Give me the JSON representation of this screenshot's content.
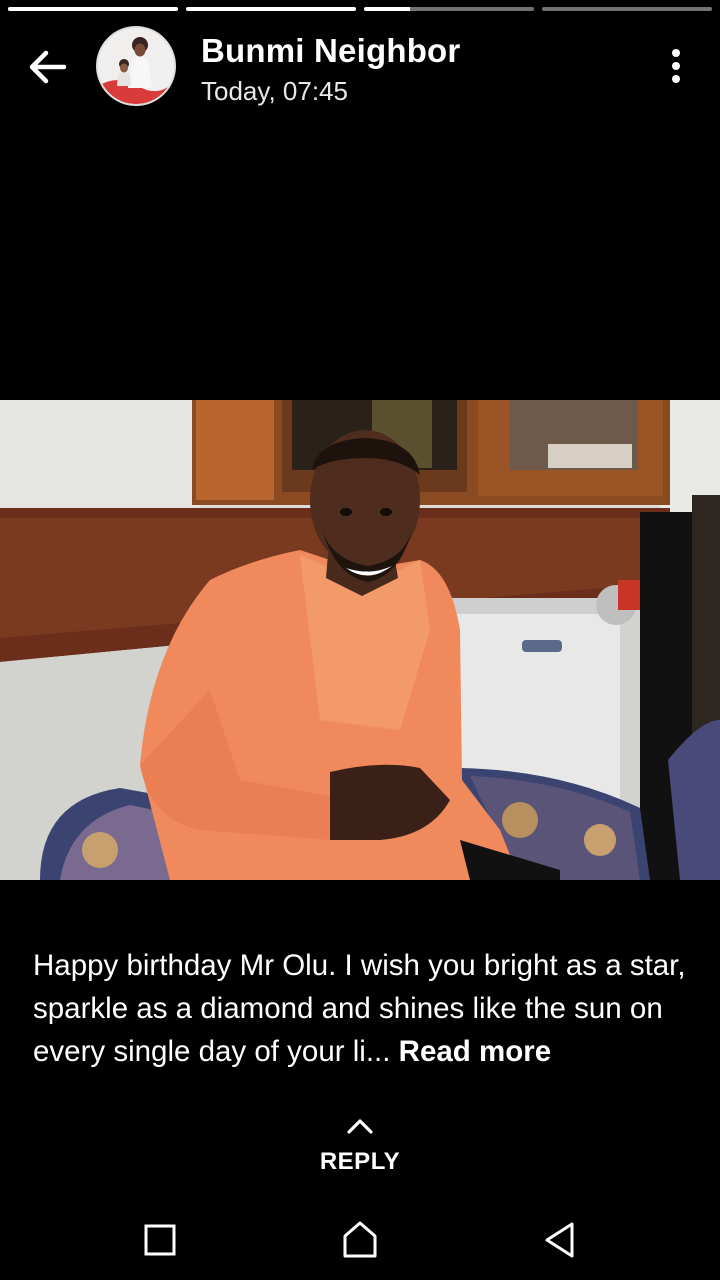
{
  "story": {
    "segments": [
      {
        "progress": 1.0
      },
      {
        "progress": 1.0
      },
      {
        "progress": 0.27
      },
      {
        "progress": 0.0
      }
    ]
  },
  "header": {
    "name": "Bunmi Neighbor",
    "time": "Today, 07:45",
    "back_icon": "arrow-left-icon",
    "menu_icon": "more-vertical-icon"
  },
  "caption": {
    "text": "Happy birthday Mr Olu. I wish you bright as a star, sparkle as a diamond and shines like the sun on every single day of your li... ",
    "read_more": "Read more"
  },
  "reply": {
    "label": "REPLY",
    "icon": "chevron-up-icon"
  },
  "navbar": {
    "recents_icon": "square-icon",
    "home_icon": "home-icon",
    "back_icon": "triangle-back-icon"
  },
  "colors": {
    "background": "#000000",
    "text": "#ffffff",
    "shirt": "#f08a5d"
  }
}
